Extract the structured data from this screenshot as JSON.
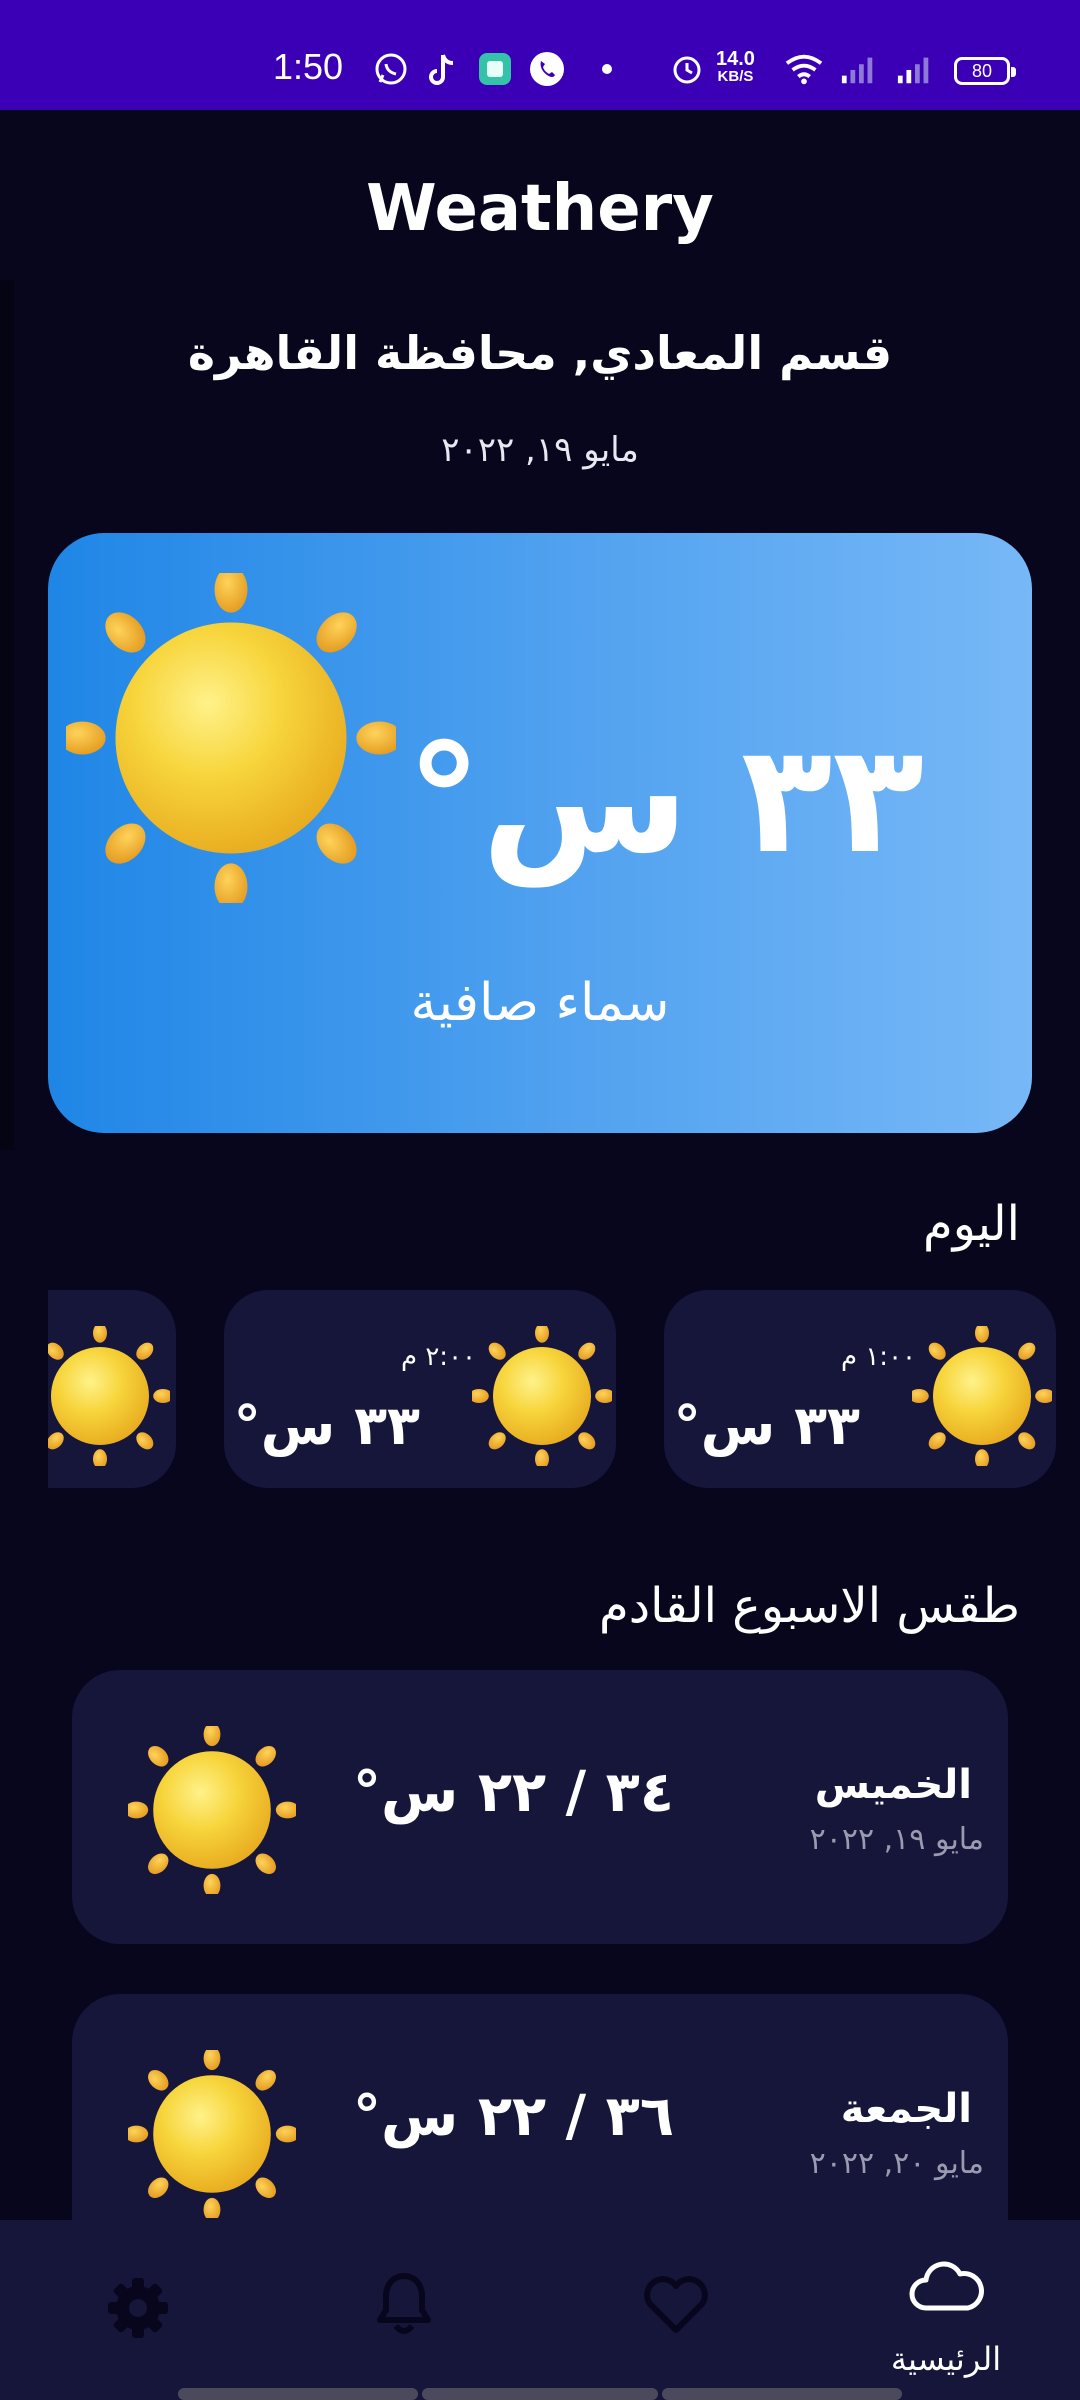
{
  "status_bar": {
    "time": "1:50",
    "net_speed_value": "14.0",
    "net_speed_unit": "KB/S",
    "battery": "80"
  },
  "app": {
    "title": "Weathery"
  },
  "location": "قسم المعادي, محافظة القاهرة",
  "date": "مايو ١٩, ٢٠٢٢",
  "current": {
    "temperature": "٣٣ س°",
    "condition": "سماء صافية",
    "icon": "sun-icon"
  },
  "today": {
    "title": "اليوم",
    "hours": [
      {
        "time": "١:٠٠ م",
        "temp": "٣٣ س°",
        "icon": "sun-icon"
      },
      {
        "time": "٢:٠٠ م",
        "temp": "٣٣ س°",
        "icon": "sun-icon"
      },
      {
        "time": "",
        "temp": "",
        "icon": "sun-icon"
      }
    ]
  },
  "week": {
    "title": "طقس الاسبوع القادم",
    "days": [
      {
        "name": "الخميس",
        "date": "مايو ١٩, ٢٠٢٢",
        "range": "٣٤ / ٢٢ س°",
        "icon": "sun-icon"
      },
      {
        "name": "الجمعة",
        "date": "مايو ٢٠, ٢٠٢٢",
        "range": "٣٦ / ٢٢ س°",
        "icon": "sun-icon"
      }
    ]
  },
  "nav": {
    "home_label": "الرئيسية",
    "items": [
      "home-icon",
      "favorites-icon",
      "notifications-icon",
      "settings-icon"
    ]
  },
  "colors": {
    "background": "#07061c",
    "status_bar": "#3b00b6",
    "card": "#16153a",
    "hero_gradient_start": "#1f86e6",
    "hero_gradient_end": "#77b8f7",
    "sun": "#f5c531"
  }
}
